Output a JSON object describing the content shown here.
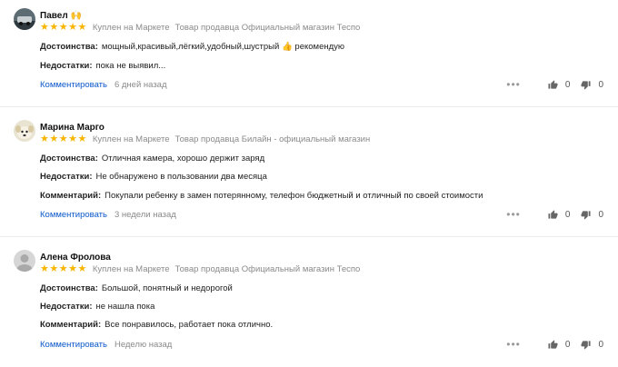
{
  "reviews": [
    {
      "author": "Павел",
      "author_emoji": "🙌",
      "avatar_icon": "car-photo-avatar",
      "rating": 5,
      "purchase_label": "Куплен на Маркете",
      "seller_label": "Товар продавца Официальный магазин Теспо",
      "pros_label": "Достоинства:",
      "pros": "мощный,красивый,лёгкий,удобный,шустрый 👍 рекомендую",
      "cons_label": "Недостатки:",
      "cons": "пока не выявил...",
      "comment_label": "",
      "comment": "",
      "comment_link": "Комментировать",
      "ago": "6 дней назад",
      "likes": "0",
      "dislikes": "0"
    },
    {
      "author": "Марина Марго",
      "author_emoji": "",
      "avatar_icon": "dog-photo-avatar",
      "rating": 5,
      "purchase_label": "Куплен на Маркете",
      "seller_label": "Товар продавца Билайн - официальный магазин",
      "pros_label": "Достоинства:",
      "pros": "Отличная камера, хорошо держит заряд",
      "cons_label": "Недостатки:",
      "cons": "Не обнаружено в пользовании два месяца",
      "comment_label": "Комментарий:",
      "comment": "Покупали ребенку в замен потерянному, телефон бюджетный и отличный по своей стоимости",
      "comment_link": "Комментировать",
      "ago": "3 недели назад",
      "likes": "0",
      "dislikes": "0"
    },
    {
      "author": "Алена Фролова",
      "author_emoji": "",
      "avatar_icon": "default-user-avatar",
      "rating": 5,
      "purchase_label": "Куплен на Маркете",
      "seller_label": "Товар продавца Официальный магазин Теспо",
      "pros_label": "Достоинства:",
      "pros": "Большой, понятный и недорогой",
      "cons_label": "Недостатки:",
      "cons": "не нашла пока",
      "comment_label": "Комментарий:",
      "comment": "Все понравилось, работает пока отлично.",
      "comment_link": "Комментировать",
      "ago": "Неделю назад",
      "likes": "0",
      "dislikes": "0"
    }
  ],
  "colors": {
    "star": "#f7b500",
    "link": "#0a58ca",
    "muted": "#8a8a8a"
  },
  "icons": {
    "star": "★",
    "more": "•••",
    "like": "thumbs-up-icon",
    "dislike": "thumbs-down-icon"
  }
}
